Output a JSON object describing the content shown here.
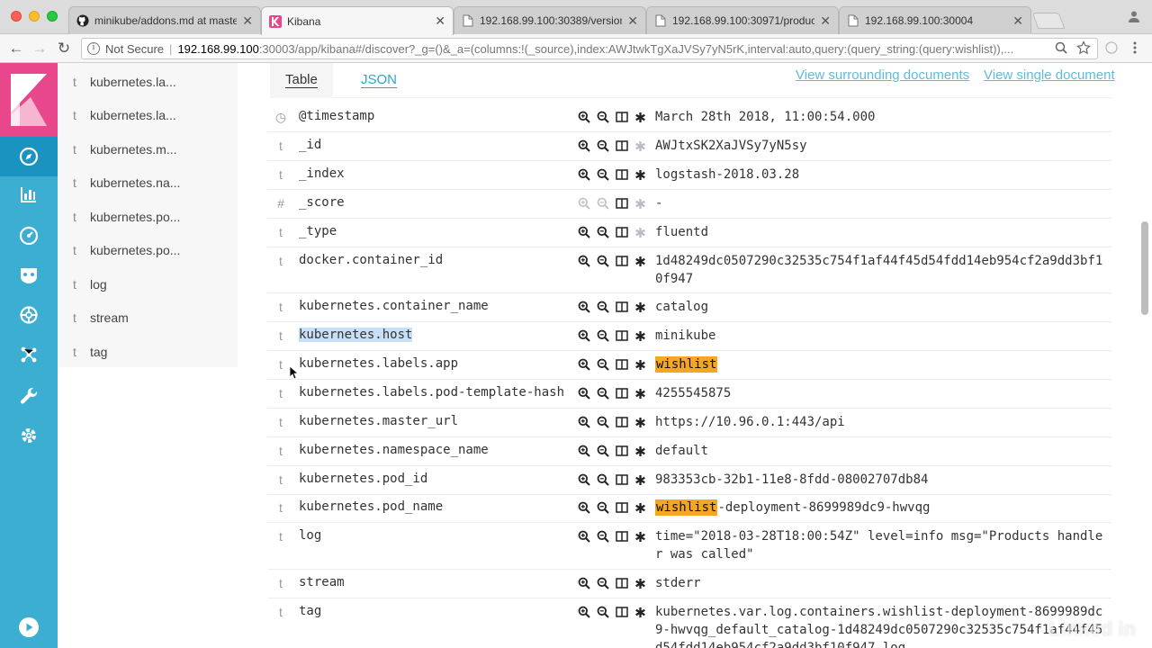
{
  "browser": {
    "tabs": [
      {
        "title": "minikube/addons.md at maste",
        "icon": "github-icon"
      },
      {
        "title": "Kibana",
        "icon": "kibana-icon",
        "active": true
      },
      {
        "title": "192.168.99.100:30389/version",
        "icon": "page-icon"
      },
      {
        "title": "192.168.99.100:30971/product",
        "icon": "page-icon"
      },
      {
        "title": "192.168.99.100:30004",
        "icon": "page-icon"
      }
    ],
    "address": {
      "security": "Not Secure",
      "host": "192.168.99.100",
      "rest": ":30003/app/kibana#/discover?_g=()&_a=(columns:!(_source),index:AWJtwkTgXaJVSy7yN5rK,interval:auto,query:(query_string:(query:wishlist)),..."
    }
  },
  "kibana_nav": {
    "items": [
      "discover-icon",
      "visualize-icon",
      "dashboard-icon",
      "timelion-icon",
      "apm-icon",
      "graph-icon",
      "dev-tools-icon",
      "management-icon",
      "play-icon"
    ],
    "accent": "#3caed2",
    "logo_color": "#e8478b"
  },
  "fields": [
    {
      "type": "t",
      "name": "kubernetes.la..."
    },
    {
      "type": "t",
      "name": "kubernetes.la..."
    },
    {
      "type": "t",
      "name": "kubernetes.m..."
    },
    {
      "type": "t",
      "name": "kubernetes.na..."
    },
    {
      "type": "t",
      "name": "kubernetes.po..."
    },
    {
      "type": "t",
      "name": "kubernetes.po..."
    },
    {
      "type": "t",
      "name": "log"
    },
    {
      "type": "t",
      "name": "stream"
    },
    {
      "type": "t",
      "name": "tag"
    }
  ],
  "doc_view": {
    "tabs": {
      "table": "Table",
      "json": "JSON"
    },
    "links": {
      "surrounding": "View surrounding documents",
      "single": "View single document"
    },
    "highlight_term": "wishlist",
    "rows": [
      {
        "type": "◷",
        "name": "@timestamp",
        "value": "March 28th 2018, 11:00:54.000"
      },
      {
        "type": "t",
        "name": "_id",
        "value": "AWJtxSK2XaJVSy7yN5sy",
        "star_muted": true
      },
      {
        "type": "t",
        "name": "_index",
        "value": "logstash-2018.03.28"
      },
      {
        "type": "#",
        "name": "_score",
        "value": " -",
        "muted": true
      },
      {
        "type": "t",
        "name": "_type",
        "value": "fluentd",
        "star_muted": true
      },
      {
        "type": "t",
        "name": "docker.container_id",
        "value": "1d48249dc0507290c32535c754f1af44f45d54fdd14eb954cf2a9dd3bf10f947"
      },
      {
        "type": "t",
        "name": "kubernetes.container_name",
        "value": "catalog"
      },
      {
        "type": "t",
        "name": "kubernetes.host",
        "value": "minikube",
        "name_selected": true
      },
      {
        "type": "t",
        "name": "kubernetes.labels.app",
        "value": "wishlist",
        "value_mark": true
      },
      {
        "type": "t",
        "name": "kubernetes.labels.pod-template-hash",
        "value": "4255545875"
      },
      {
        "type": "t",
        "name": "kubernetes.master_url",
        "value": "https://10.96.0.1:443/api"
      },
      {
        "type": "t",
        "name": "kubernetes.namespace_name",
        "value": "default"
      },
      {
        "type": "t",
        "name": "kubernetes.pod_id",
        "value": "983353cb-32b1-11e8-8fdd-08002707db84"
      },
      {
        "type": "t",
        "name": "kubernetes.pod_name",
        "value_mark": true,
        "value_prefix": "wishlist",
        "value": "-deployment-8699989dc9-hwvqg"
      },
      {
        "type": "t",
        "name": "log",
        "value": "time=\"2018-03-28T18:00:54Z\" level=info msg=\"Products handler was called\""
      },
      {
        "type": "t",
        "name": "stream",
        "value": "stderr"
      },
      {
        "type": "t",
        "name": "tag",
        "value": "kubernetes.var.log.containers.wishlist-deployment-8699989dc9-hwvqg_default_catalog-1d48249dc0507290c32535c754f1af44f45d54fdd14eb954cf2a9dd3bf10f947.log"
      }
    ]
  },
  "watermark": "Linked in"
}
